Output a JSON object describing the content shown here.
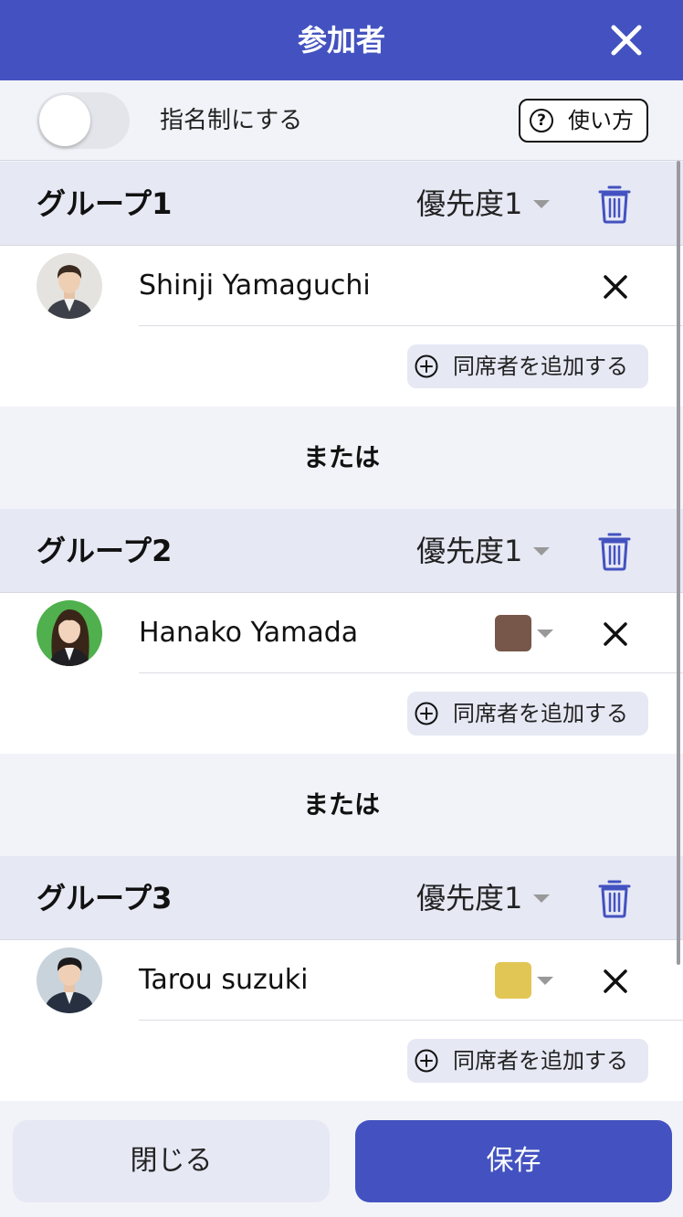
{
  "header": {
    "title": "参加者"
  },
  "nomination": {
    "label": "指名制にする",
    "enabled": false,
    "howto_label": "使い方"
  },
  "groups": [
    {
      "title": "グループ1",
      "priority": "優先度1",
      "members": [
        {
          "name": "Shinji Yamaguchi",
          "color": null
        }
      ],
      "add_companion_label": "同席者を追加する"
    },
    {
      "title": "グループ2",
      "priority": "優先度1",
      "members": [
        {
          "name": "Hanako Yamada",
          "color": "#76574a"
        }
      ],
      "add_companion_label": "同席者を追加する"
    },
    {
      "title": "グループ3",
      "priority": "優先度1",
      "members": [
        {
          "name": "Tarou suzuki",
          "color": "#e2c655"
        }
      ],
      "add_companion_label": "同席者を追加する"
    }
  ],
  "separators": [
    "または",
    "または"
  ],
  "footer": {
    "close_label": "閉じる",
    "save_label": "保存"
  },
  "colors": {
    "accent": "#4352c0",
    "group_header_bg": "#e6e8f4",
    "page_bg": "#f2f3f8"
  }
}
